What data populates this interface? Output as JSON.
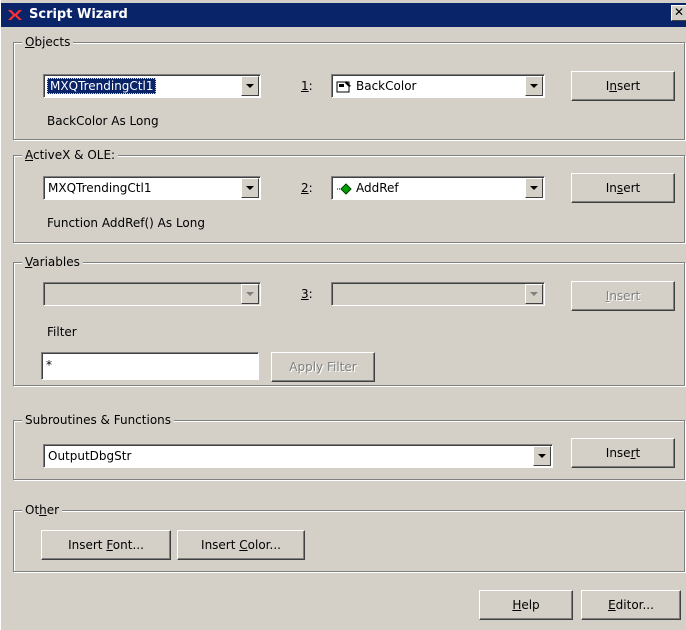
{
  "window": {
    "title": "Script Wizard",
    "close_glyph": "✕",
    "title_bar_color": "#0a246a",
    "face_color": "#d4d0c8"
  },
  "objects": {
    "group_label_accel": "O",
    "group_label_rest": "bjects",
    "combo_value": "MXQTrendingCtl1",
    "number_accel": "1",
    "number_rest": ":",
    "property_value": "BackColor",
    "property_icon": "property-icon",
    "insert_pre": "I",
    "insert_accel": "n",
    "insert_post": "sert",
    "description": "BackColor As Long"
  },
  "activex": {
    "group_label_accel": "A",
    "group_label_rest": "ctiveX & OLE:",
    "combo_value": "MXQTrendingCtl1",
    "number_accel": "2",
    "number_rest": ":",
    "method_value": "AddRef",
    "method_icon": "method-icon",
    "insert_pre": "In",
    "insert_accel": "s",
    "insert_post": "ert",
    "description": "Function AddRef() As Long"
  },
  "variables": {
    "group_label_accel": "V",
    "group_label_rest": "ariables",
    "combo_value": "",
    "number_accel": "3",
    "number_rest": ":",
    "value2": "",
    "insert_pre": "",
    "insert_accel": "I",
    "insert_post": "nsert",
    "filter_label": "Filter",
    "filter_value": "*",
    "apply_filter_label": "Apply Filter"
  },
  "subroutines": {
    "group_label": "Subroutines & Functions",
    "combo_value": "OutputDbgStr",
    "insert_pre": "Inse",
    "insert_accel": "r",
    "insert_post": "t"
  },
  "other": {
    "group_label_pre": "Ot",
    "group_label_accel": "h",
    "group_label_post": "er",
    "insert_font_pre": "Insert ",
    "insert_font_accel": "F",
    "insert_font_post": "ont...",
    "insert_color_pre": "Insert ",
    "insert_color_accel": "C",
    "insert_color_post": "olor..."
  },
  "footer": {
    "help_accel": "H",
    "help_rest": "elp",
    "editor_accel": "E",
    "editor_rest": "ditor..."
  }
}
